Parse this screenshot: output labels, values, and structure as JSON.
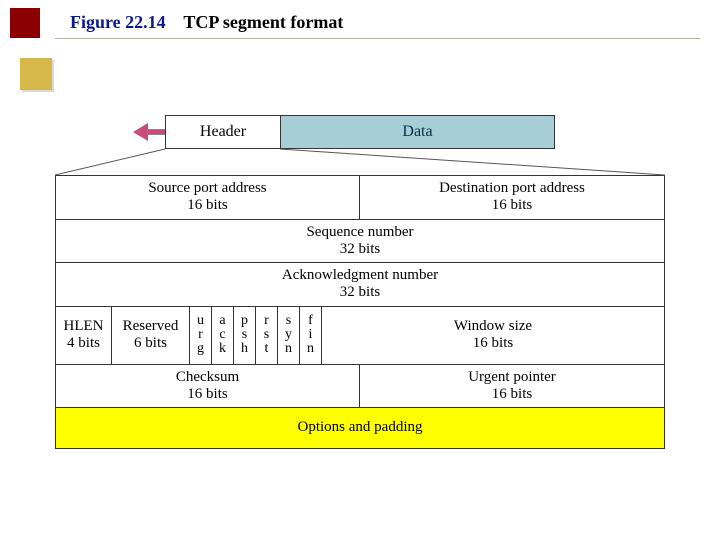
{
  "title": {
    "fig": "Figure 22.14",
    "caption": "TCP segment format"
  },
  "top": {
    "header": "Header",
    "data": "Data"
  },
  "row1": {
    "src": {
      "a": "Source port address",
      "b": "16 bits"
    },
    "dst": {
      "a": "Destination port address",
      "b": "16 bits"
    }
  },
  "row2": {
    "a": "Sequence number",
    "b": "32 bits"
  },
  "row3": {
    "a": "Acknowledgment number",
    "b": "32 bits"
  },
  "row4": {
    "hlen": {
      "a": "HLEN",
      "b": "4 bits"
    },
    "resv": {
      "a": "Reserved",
      "b": "6 bits"
    },
    "flags": {
      "urg": [
        "u",
        "r",
        "g"
      ],
      "ack": [
        "a",
        "c",
        "k"
      ],
      "psh": [
        "p",
        "s",
        "h"
      ],
      "rst": [
        "r",
        "s",
        "t"
      ],
      "syn": [
        "s",
        "y",
        "n"
      ],
      "fin": [
        "f",
        "i",
        "n"
      ]
    },
    "win": {
      "a": "Window size",
      "b": "16 bits"
    }
  },
  "row5": {
    "chk": {
      "a": "Checksum",
      "b": "16 bits"
    },
    "urg": {
      "a": "Urgent pointer",
      "b": "16 bits"
    }
  },
  "row6": {
    "a": "Options and padding"
  }
}
